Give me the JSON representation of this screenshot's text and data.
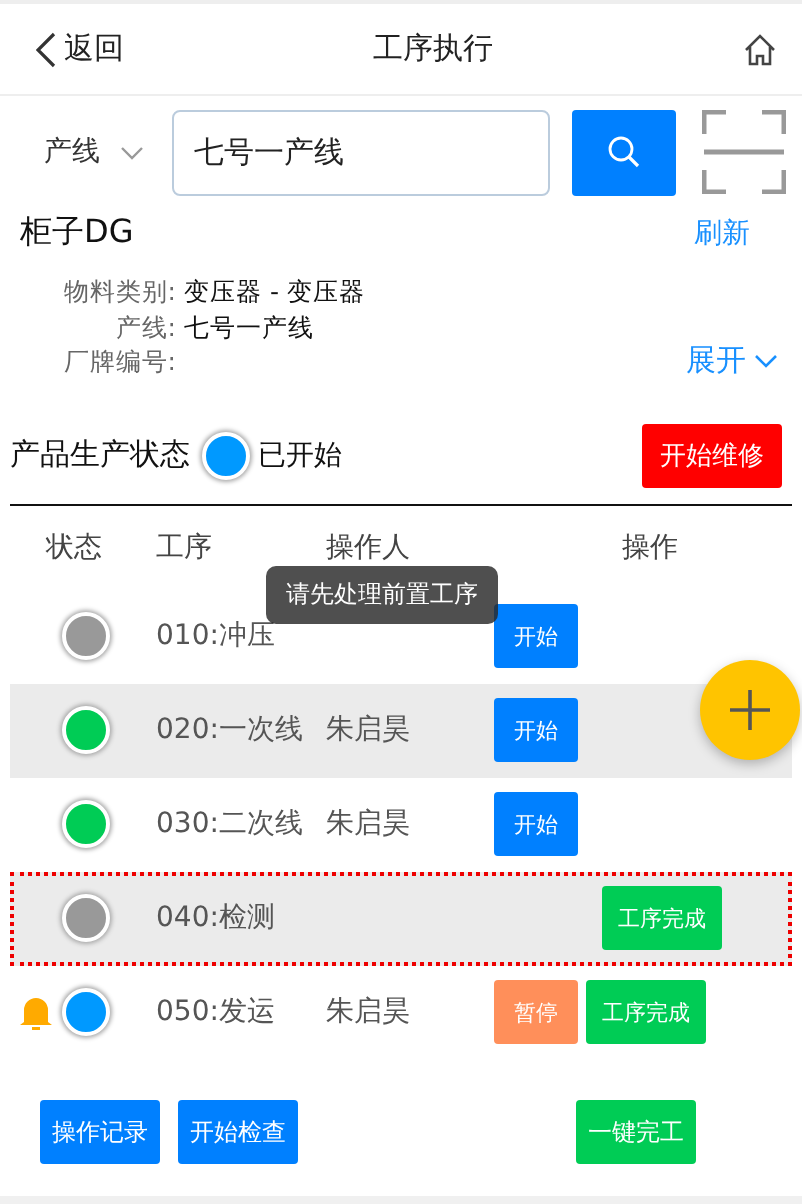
{
  "header": {
    "back": "返回",
    "title": "工序执行"
  },
  "search": {
    "filter": "产线",
    "value": "七号一产线"
  },
  "product": {
    "name": "柜子DG",
    "refresh": "刷新",
    "expand": "展开",
    "fields": [
      {
        "label": "物料类别:",
        "value": "变压器 - 变压器"
      },
      {
        "label": "产线:",
        "value": "七号一产线"
      },
      {
        "label": "厂牌编号:"
      }
    ]
  },
  "status": {
    "label": "产品生产状态",
    "value": "已开始",
    "color": "#0099ff",
    "action": "开始维修"
  },
  "table": {
    "columns": [
      "状态",
      "工序",
      "操作人",
      "操作"
    ],
    "rows": [
      {
        "color": "#999999",
        "process": "010:冲压",
        "operator": "",
        "highlighted": false,
        "selected": false,
        "alert": false,
        "actions": [
          {
            "label": "开始",
            "kind": "start"
          }
        ]
      },
      {
        "color": "#00cc55",
        "process": "020:一次线",
        "operator": "朱启昊",
        "highlighted": true,
        "selected": false,
        "alert": false,
        "actions": [
          {
            "label": "开始",
            "kind": "start"
          }
        ]
      },
      {
        "color": "#00cc55",
        "process": "030:二次线",
        "operator": "朱启昊",
        "highlighted": false,
        "selected": false,
        "alert": false,
        "actions": [
          {
            "label": "开始",
            "kind": "start"
          }
        ]
      },
      {
        "color": "#999999",
        "process": "040:检测",
        "operator": "",
        "highlighted": true,
        "selected": true,
        "alert": false,
        "actions": [
          {
            "label": "工序完成",
            "kind": "complete"
          }
        ]
      },
      {
        "color": "#0099ff",
        "process": "050:发运",
        "operator": "朱启昊",
        "highlighted": false,
        "selected": false,
        "alert": true,
        "actions": [
          {
            "label": "暂停",
            "kind": "pause"
          },
          {
            "label": "工序完成",
            "kind": "complete"
          }
        ]
      }
    ]
  },
  "tooltip": "请先处理前置工序",
  "footer": [
    {
      "label": "操作记录",
      "kind": "primary"
    },
    {
      "label": "开始检查",
      "kind": "primary"
    },
    {
      "label": "一键完工",
      "kind": "success"
    }
  ]
}
